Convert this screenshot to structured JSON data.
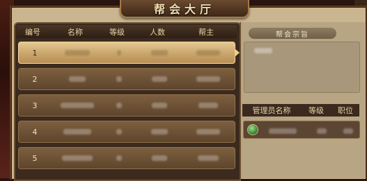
{
  "title": "帮会大厅",
  "guild_list": {
    "headers": [
      "编号",
      "名称",
      "等级",
      "人数",
      "帮主"
    ],
    "rows": [
      {
        "index": "1",
        "selected": true
      },
      {
        "index": "2",
        "selected": false
      },
      {
        "index": "3",
        "selected": false
      },
      {
        "index": "4",
        "selected": false
      },
      {
        "index": "5",
        "selected": false
      }
    ]
  },
  "guild_purpose": {
    "label": "帮会宗旨"
  },
  "managers": {
    "headers": [
      "管理员名称",
      "等级",
      "职位"
    ],
    "gem_icon": "green-gem-icon"
  },
  "colors": {
    "panel": "#c9b58f",
    "row": "#6c5135",
    "row_selected": "#d9b980",
    "header_text": "#e9d3a8"
  }
}
